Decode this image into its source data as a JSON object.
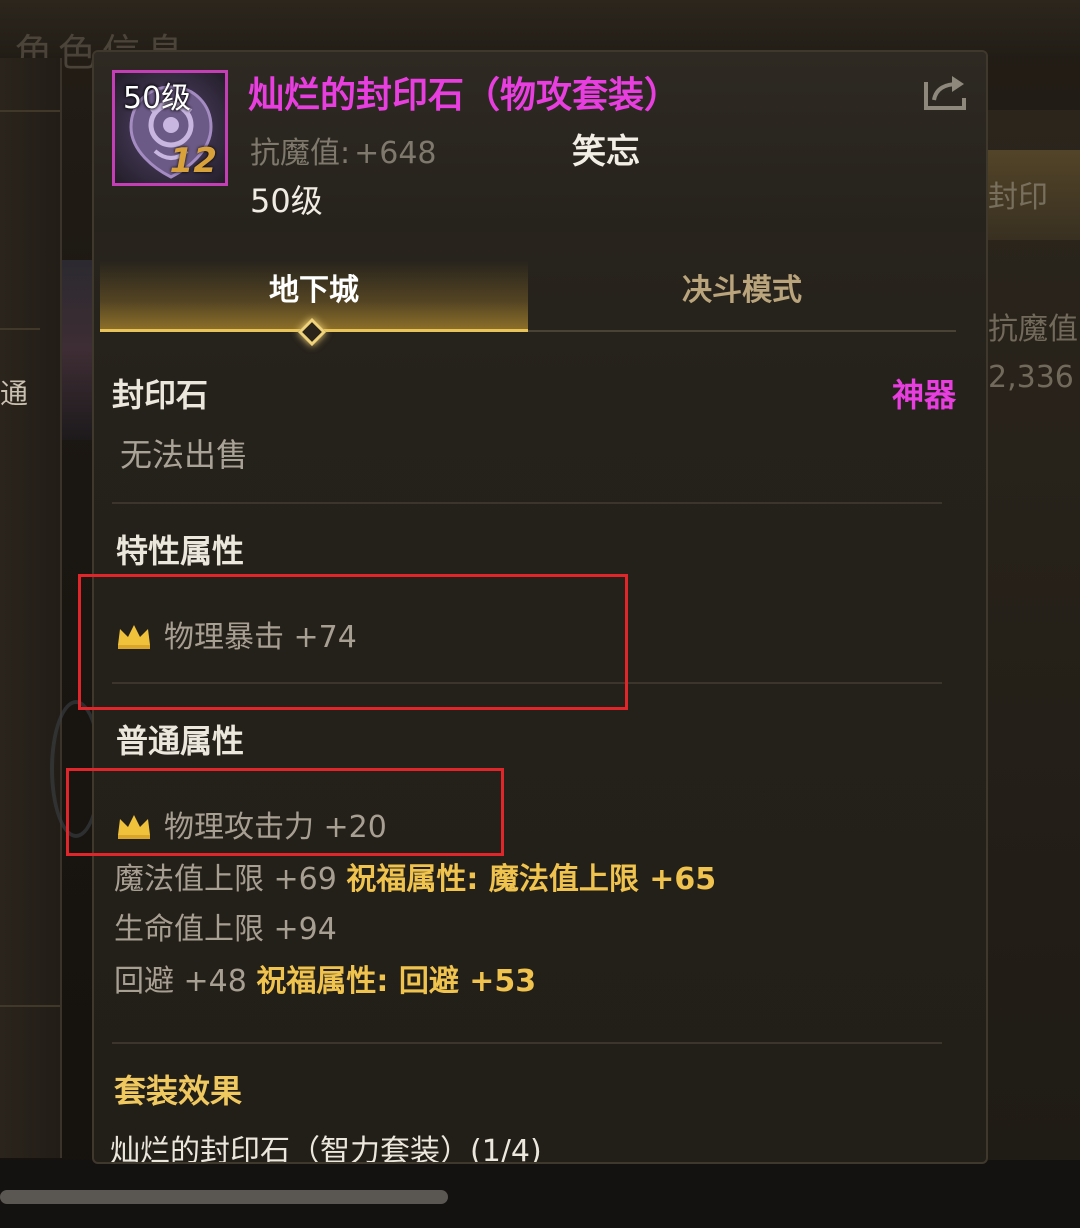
{
  "background": {
    "title": "角色信息",
    "left_text": "通",
    "right_texts": [
      "封印",
      "抗魔值",
      "2,336"
    ]
  },
  "tooltip": {
    "icon": {
      "level": "50级",
      "grade": "12"
    },
    "name": "灿烂的封印石（物攻套装）",
    "resist_label": "抗魔值:",
    "resist_value": "+648",
    "owner": "笑忘",
    "level": "50级",
    "share_icon": "share-icon"
  },
  "tabs": [
    {
      "label": "地下城",
      "active": true
    },
    {
      "label": "决斗模式",
      "active": false
    }
  ],
  "info": {
    "category": "封印石",
    "rarity": "神器",
    "sell_status": "无法出售"
  },
  "special_attributes": {
    "title": "特性属性",
    "items": [
      {
        "text": "物理暴击 +74",
        "icon": "crown-icon"
      }
    ]
  },
  "normal_attributes": {
    "title": "普通属性",
    "items": [
      {
        "text": "物理攻击力 +20",
        "icon": "crown-icon"
      }
    ],
    "extra": [
      {
        "text": "魔法值上限 +69",
        "bless": "祝福属性: 魔法值上限 +65"
      },
      {
        "text": "生命值上限 +94",
        "bless": ""
      },
      {
        "text": "回避 +48",
        "bless": "祝福属性: 回避 +53"
      }
    ]
  },
  "set_effect": {
    "title": "套装效果",
    "item": "灿烂的封印石（智力套装）(1/4)"
  },
  "colors": {
    "rarity": "#e83ee0",
    "bless": "#efc34e",
    "highlight_box": "#e0262a"
  }
}
